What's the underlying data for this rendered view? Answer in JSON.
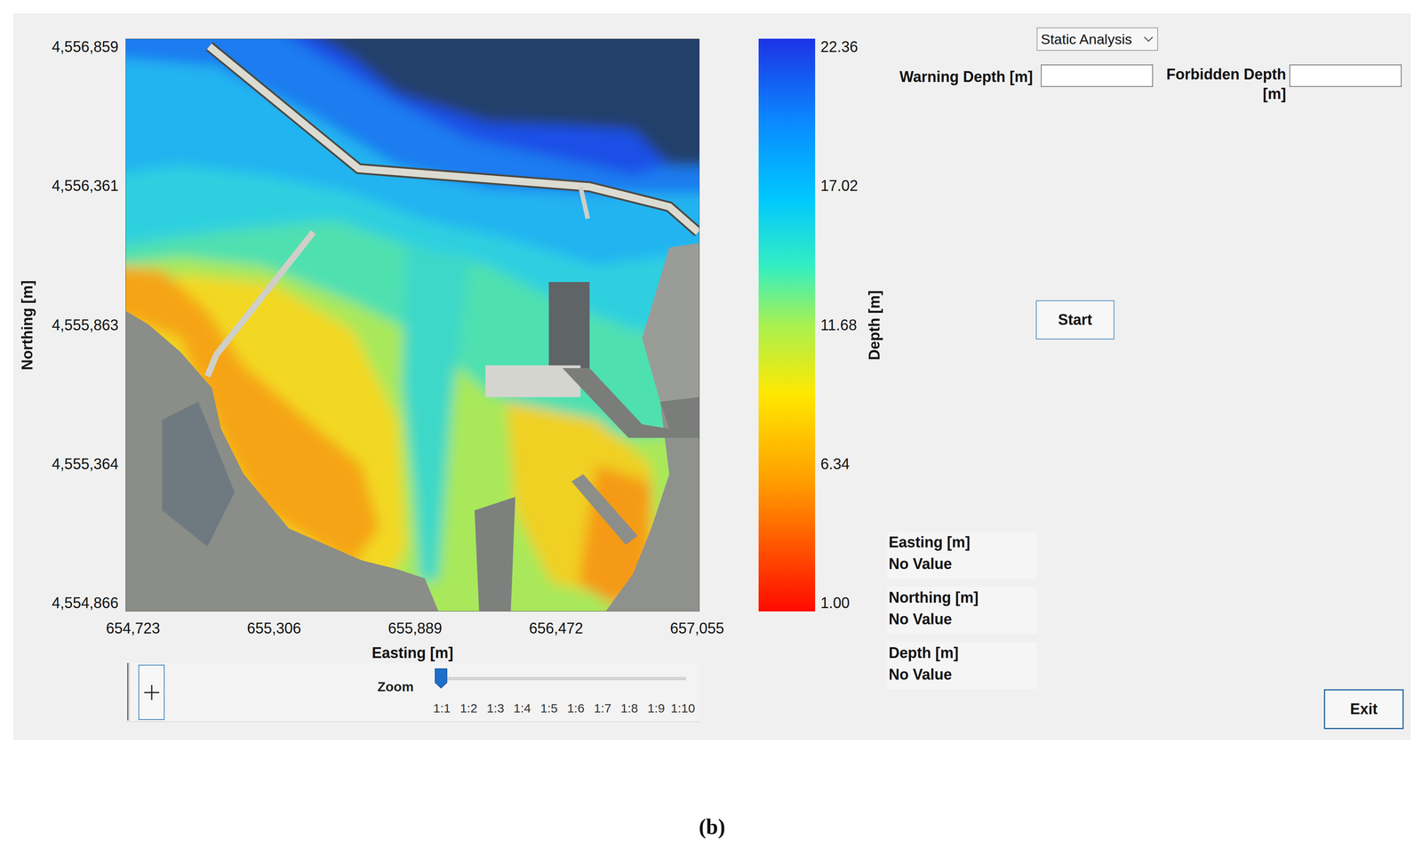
{
  "map": {
    "y_axis": {
      "label": "Northing [m]",
      "ticks": [
        "4,556,859",
        "4,556,361",
        "4,555,863",
        "4,555,364",
        "4,554,866"
      ]
    },
    "x_axis": {
      "label": "Easting [m]",
      "ticks": [
        "654,723",
        "655,306",
        "655,889",
        "656,472",
        "657,055"
      ]
    },
    "colorbar": {
      "label": "Depth [m]",
      "ticks": [
        "22.36",
        "17.02",
        "11.68",
        "6.34",
        "1.00"
      ]
    }
  },
  "zoom": {
    "label": "Zoom",
    "ticks": [
      "1:1",
      "1:2",
      "1:3",
      "1:4",
      "1:5",
      "1:6",
      "1:7",
      "1:8",
      "1:9",
      "1:10"
    ],
    "level": 0
  },
  "mode_dropdown": {
    "value": "Static Analysis"
  },
  "fields": [
    {
      "label": "Warning Depth [m]",
      "value": ""
    },
    {
      "label": "Forbidden Depth [m]",
      "value": ""
    }
  ],
  "buttons": {
    "start": "Start",
    "exit": "Exit"
  },
  "readouts": [
    {
      "label": "Easting [m]",
      "value": "No Value"
    },
    {
      "label": "Northing [m]",
      "value": "No Value"
    },
    {
      "label": "Depth [m]",
      "value": "No Value"
    }
  ],
  "caption": "(b)"
}
